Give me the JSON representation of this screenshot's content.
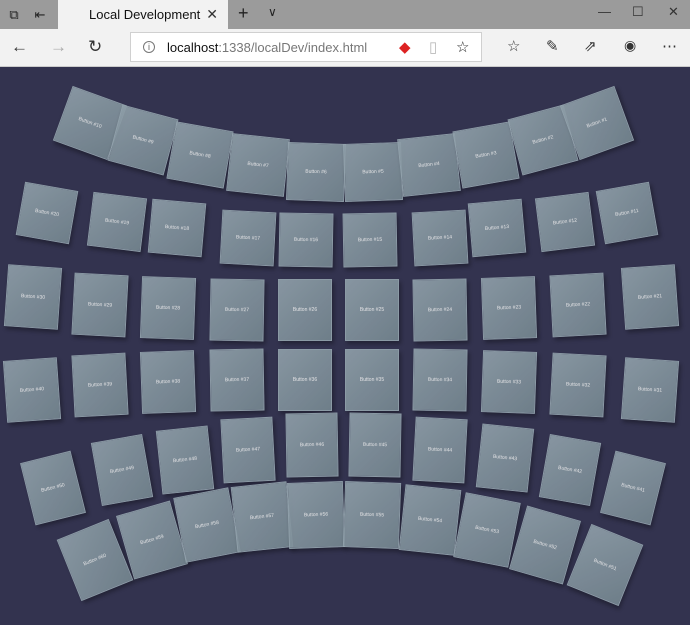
{
  "browser": {
    "tab_title": "Local Development",
    "url_host": "localhost",
    "url_rest": ":1338/localDev/index.html",
    "icons": [
      "tab-preview-icon",
      "set-aside-tabs-icon",
      "close-tab-icon",
      "new-tab-icon",
      "tab-menu-icon",
      "minimize-icon",
      "maximize-icon",
      "close-window-icon",
      "back-icon",
      "forward-icon",
      "refresh-icon",
      "site-info-icon",
      "extension-icon",
      "reading-view-icon",
      "favorite-star-icon",
      "favorites-list-icon",
      "pen-notes-icon",
      "share-icon",
      "extension-badge-icon",
      "more-icon"
    ]
  },
  "colors": {
    "background": "#33334f",
    "button": "#8494a0"
  },
  "grid": {
    "rows": [
      [
        "Button #10",
        "Button #9",
        "Button #8",
        "Button #7",
        "Button #6",
        "Button #5",
        "Button #4",
        "Button #3",
        "Button #2",
        "Button #1"
      ],
      [
        "Button #20",
        "Button #19",
        "Button #18",
        "Button #17",
        "Button #16",
        "Button #15",
        "Button #14",
        "Button #13",
        "Button #12",
        "Button #11"
      ],
      [
        "Button #30",
        "Button #29",
        "Button #28",
        "Button #27",
        "Button #26",
        "Button #25",
        "Button #24",
        "Button #23",
        "Button #22",
        "Button #21"
      ],
      [
        "Button #40",
        "Button #39",
        "Button #38",
        "Button #37",
        "Button #36",
        "Button #35",
        "Button #34",
        "Button #33",
        "Button #32",
        "Button #31"
      ],
      [
        "Button #50",
        "Button #49",
        "Button #48",
        "Button #47",
        "Button #46",
        "Button #45",
        "Button #44",
        "Button #43",
        "Button #42",
        "Button #41"
      ],
      [
        "Button #60",
        "Button #59",
        "Button #58",
        "Button #57",
        "Button #56",
        "Button #55",
        "Button #54",
        "Button #53",
        "Button #52",
        "Button #51"
      ]
    ]
  }
}
